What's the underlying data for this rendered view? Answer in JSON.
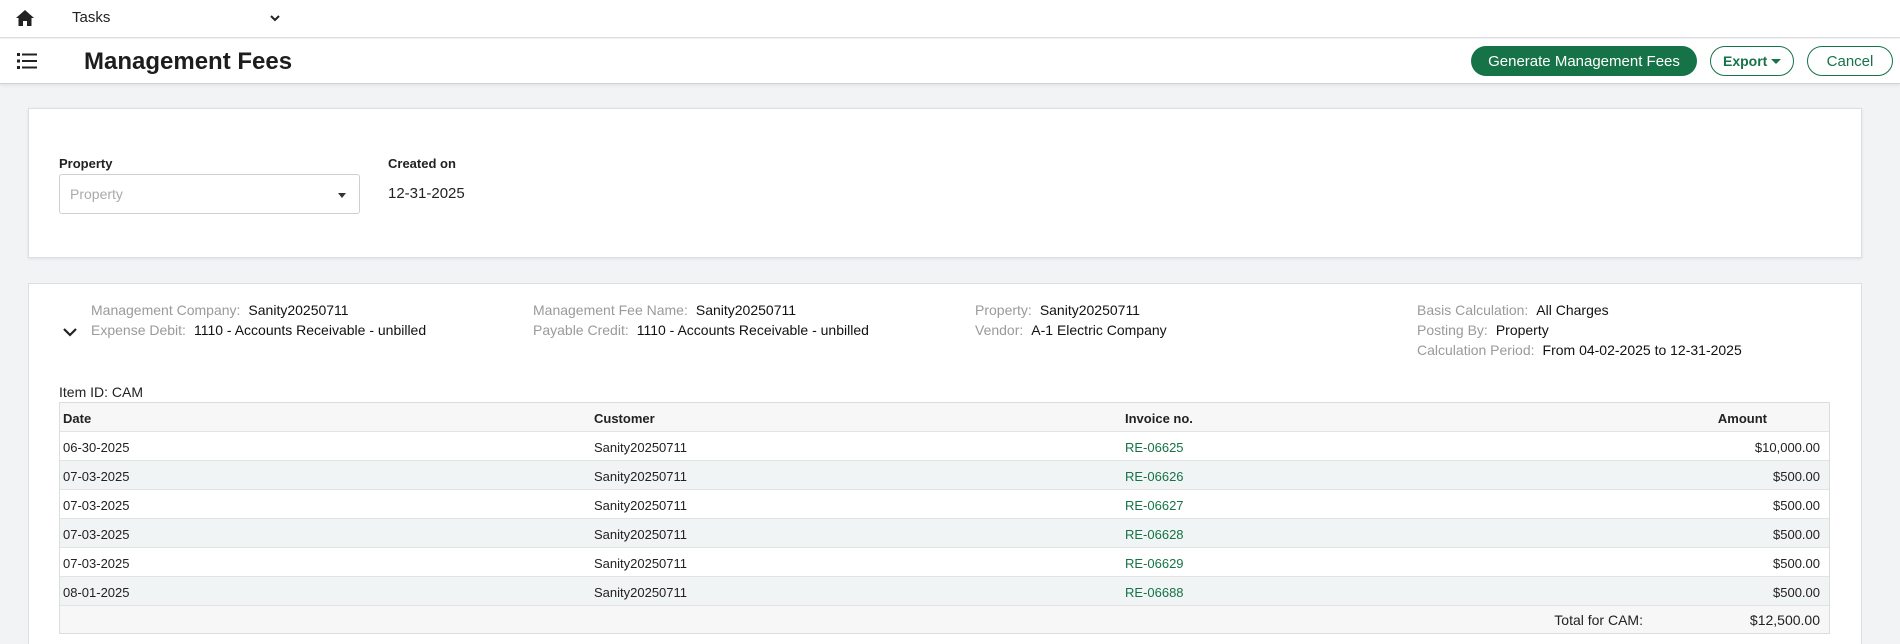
{
  "topbar": {
    "module": "Tasks",
    "icons": {
      "home": "home-icon",
      "module_dropdown": "chevron-down-icon"
    }
  },
  "header": {
    "title": "Management Fees",
    "menu_icon": "list-icon",
    "generate_label": "Generate Management Fees",
    "export_label": "Export",
    "cancel_label": "Cancel"
  },
  "filters": {
    "property_label": "Property",
    "property_placeholder": "Property",
    "created_label": "Created on",
    "created_value": "12-31-2025"
  },
  "detail": {
    "meta": {
      "management_company": {
        "label": "Management Company:",
        "value": "Sanity20250711"
      },
      "expense_debit": {
        "label": "Expense Debit:",
        "value": "1110 - Accounts Receivable - unbilled"
      },
      "fee_name": {
        "label": "Management Fee Name:",
        "value": "Sanity20250711"
      },
      "payable_credit": {
        "label": "Payable Credit:",
        "value": "1110 - Accounts Receivable - unbilled"
      },
      "property": {
        "label": "Property:",
        "value": "Sanity20250711"
      },
      "vendor": {
        "label": "Vendor:",
        "value": "A-1 Electric Company"
      },
      "basis": {
        "label": "Basis Calculation:",
        "value": "All Charges"
      },
      "posting": {
        "label": "Posting By:",
        "value": "Property"
      },
      "period": {
        "label": "Calculation Period:",
        "value": "From 04-02-2025 to 12-31-2025"
      }
    },
    "item_id": "Item ID: CAM",
    "table": {
      "columns": {
        "date": "Date",
        "customer": "Customer",
        "invoice": "Invoice no.",
        "amount": "Amount"
      },
      "rows": [
        {
          "date": "06-30-2025",
          "customer": "Sanity20250711",
          "invoice": "RE-06625",
          "amount": "$10,000.00"
        },
        {
          "date": "07-03-2025",
          "customer": "Sanity20250711",
          "invoice": "RE-06626",
          "amount": "$500.00"
        },
        {
          "date": "07-03-2025",
          "customer": "Sanity20250711",
          "invoice": "RE-06627",
          "amount": "$500.00"
        },
        {
          "date": "07-03-2025",
          "customer": "Sanity20250711",
          "invoice": "RE-06628",
          "amount": "$500.00"
        },
        {
          "date": "07-03-2025",
          "customer": "Sanity20250711",
          "invoice": "RE-06629",
          "amount": "$500.00"
        },
        {
          "date": "08-01-2025",
          "customer": "Sanity20250711",
          "invoice": "RE-06688",
          "amount": "$500.00"
        }
      ],
      "total_label": "Total for CAM:",
      "total_value": "$12,500.00"
    }
  },
  "colors": {
    "accent": "#157347",
    "background": "#f2f3f5",
    "row_alt": "#f1f4f4"
  }
}
